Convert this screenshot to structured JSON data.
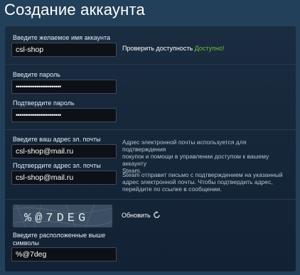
{
  "page": {
    "title": "Создание аккаунта"
  },
  "account": {
    "label": "Введите желаемое имя аккаунта",
    "value": "csl-shop",
    "check_link": "Проверить доступность",
    "status": "Доступно!"
  },
  "password": {
    "label": "Введите пароль",
    "value": "••••••••••••••••••••••••"
  },
  "confirm_password": {
    "label": "Подтвердите пароль",
    "value": "••••••••••••••••••••••••"
  },
  "email": {
    "label": "Введите ваш адрес эл. почты",
    "value": "csl-shop@mail.ru",
    "info_line1": "Адрес электронной почты используется для подтверждения",
    "info_line2": "покупок и помощи в управлении доступом к вашему аккаунту",
    "info_line3": "Steam."
  },
  "confirm_email": {
    "label": "Подтвердите адрес эл. почты",
    "value": "csl-shop@mail.ru",
    "info_line1": "Steam отправит письмо с подтверждением на указанный",
    "info_line2": "адрес электронной почты. Чтобы подтвердить адрес,",
    "info_line3": "перейдите по ссылке в сообщении."
  },
  "captcha": {
    "image_text": "%@7DEG",
    "refresh_label": "Обновить",
    "label_line1": "Введите расположенные выше",
    "label_line2": "символы",
    "value": "%@7deg"
  },
  "colors": {
    "background": "#23405a",
    "panel": "#1a2c40",
    "input_bg": "#0d1117",
    "available": "#6fbe3d"
  }
}
